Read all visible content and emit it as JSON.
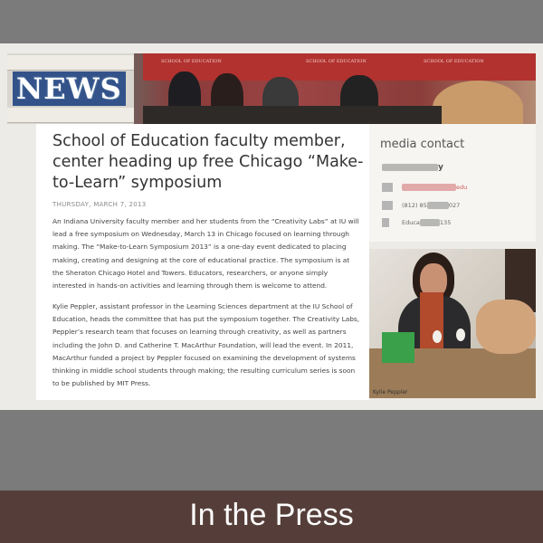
{
  "banner": {
    "news_label": "NEWS",
    "wall_text": "SCHOOL OF EDUCATION"
  },
  "article": {
    "title": "School of Education faculty member, center heading up free Chicago “Make-to-Learn” symposium",
    "date": "THURSDAY, MARCH 7, 2013",
    "paragraphs": [
      "An Indiana University faculty member and her students from the “Creativity Labs” at IU will lead a free symposium on Wednesday, March 13 in Chicago focused on learning through making. The “Make-to-Learn Symposium 2013” is a one-day event dedicated to placing making, creating and designing at the core of educational practice. The symposium is at the Sheraton Chicago Hotel and Towers. Educators, researchers, or anyone simply interested in hands-on activities and learning through them is welcome to attend.",
      "Kylie Peppler, assistant professor in the Learning Sciences department at the IU School of Education, heads the committee that has put the symposium together. The Creativity Labs, Peppler’s research team that focuses on learning through creativity, as well as partners including the John D. and Catherine T. MacArthur Foundation, will lead the event. In 2011, MacArthur funded a project by Peppler focused on examining the development of systems thinking in middle school students through making; the resulting curriculum series is soon to be published by MIT Press."
    ]
  },
  "sidebar": {
    "heading": "media contact",
    "name_suffix": "y",
    "email_suffix": "edu",
    "phone_prefix": "(812) 85",
    "phone_suffix": "027",
    "twitter_prefix": "Educa",
    "twitter_suffix": "135"
  },
  "photo": {
    "caption": "Kylie Peppler"
  },
  "footer": {
    "label": "In the Press"
  },
  "colors": {
    "footer_bg": "#553e39",
    "banner_red": "#b2322f"
  }
}
